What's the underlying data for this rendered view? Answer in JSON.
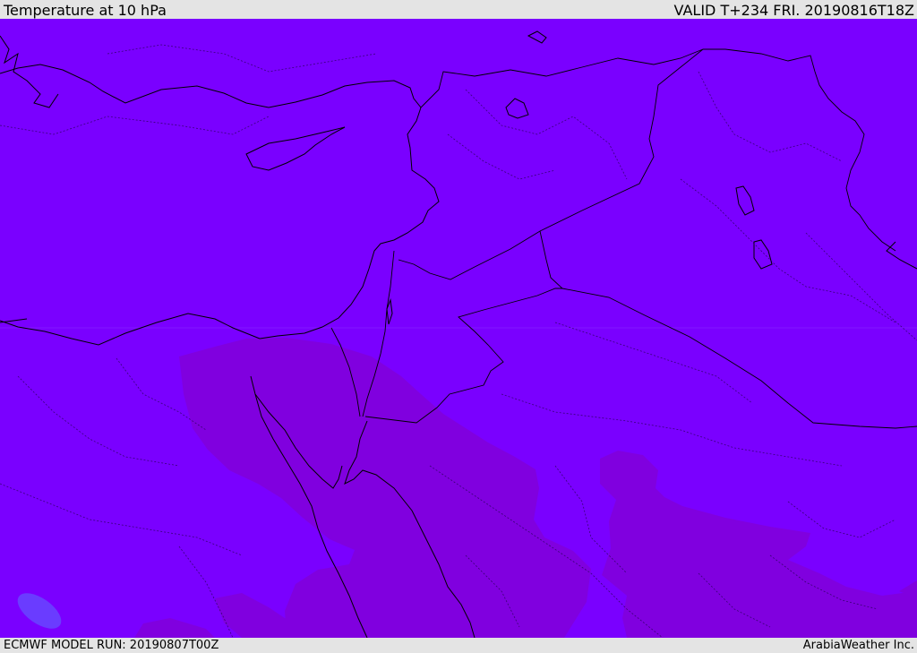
{
  "header": {
    "title": "Temperature at 10 hPa",
    "valid": "VALID T+234 FRI. 20190816T18Z"
  },
  "footer": {
    "model_run": "ECMWF MODEL RUN: 20190807T00Z",
    "credit": "ArabiaWeather Inc."
  },
  "colors": {
    "background_field": "#7a00ff",
    "warmer_field": "#8000df",
    "cool_spot": "#6a3cff",
    "borders": "#000000"
  }
}
